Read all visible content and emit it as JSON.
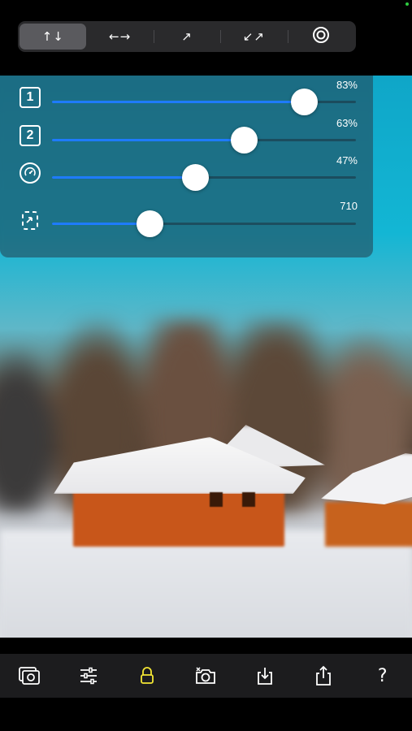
{
  "modes": [
    {
      "label": "↑↓",
      "icon": "vertical-arrows-icon",
      "active": true
    },
    {
      "label": "←→",
      "icon": "horizontal-arrows-icon",
      "active": false
    },
    {
      "label": "↗",
      "icon": "diagonal-arrow-icon",
      "active": false
    },
    {
      "label": "↙↗",
      "icon": "diagonal-double-arrow-icon",
      "active": false
    },
    {
      "label": "◎",
      "icon": "radial-icon",
      "active": false
    }
  ],
  "sliders": [
    {
      "icon_label": "1",
      "icon": "blur-1-icon",
      "value_text": "83%",
      "fraction": 0.83
    },
    {
      "icon_label": "2",
      "icon": "blur-2-icon",
      "value_text": "63%",
      "fraction": 0.63
    },
    {
      "icon_label": "",
      "icon": "speedometer-icon",
      "value_text": "47%",
      "fraction": 0.47
    },
    {
      "icon_label": "",
      "icon": "resolution-icon",
      "value_text": "710",
      "fraction": 0.32
    }
  ],
  "toolbar": {
    "icons": [
      "photos-icon",
      "adjustments-icon",
      "lock-icon",
      "camera-icon",
      "download-icon",
      "share-icon",
      "help-icon"
    ],
    "help_label": "?",
    "lock_color": "#f4e634"
  },
  "colors": {
    "accent": "#1e7bff",
    "status_dot": "#2ecc40"
  }
}
